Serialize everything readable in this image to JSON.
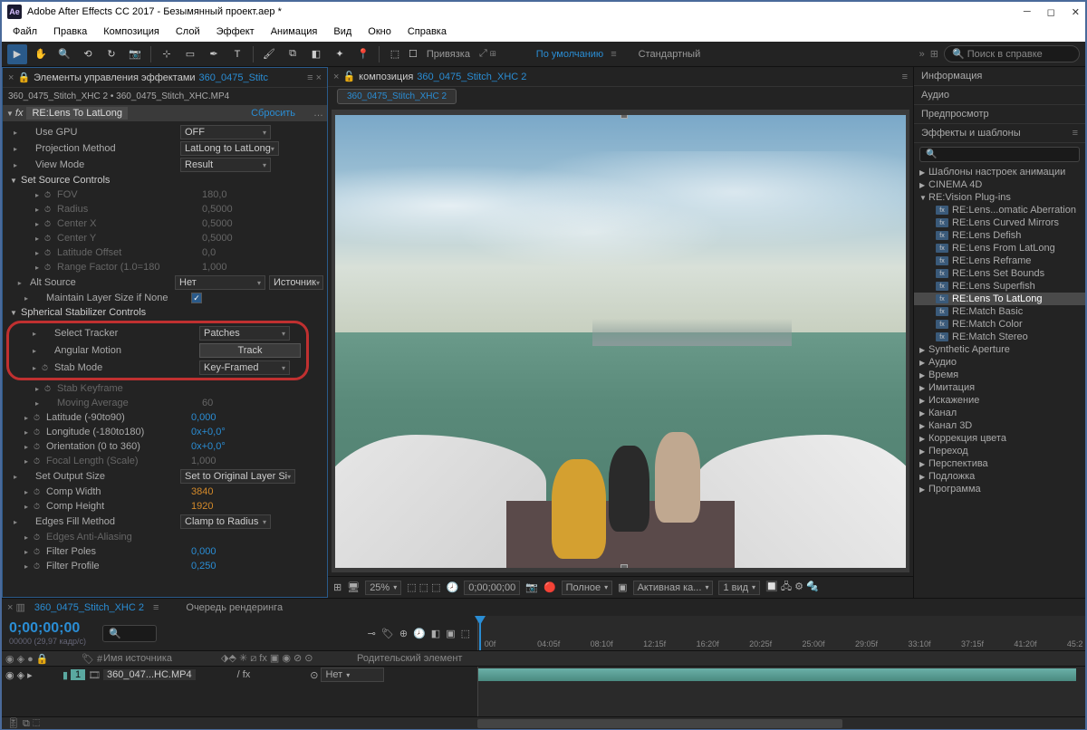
{
  "title": "Adobe After Effects CC 2017 - Безымянный проект.aep *",
  "menus": [
    "Файл",
    "Правка",
    "Композиция",
    "Слой",
    "Эффект",
    "Анимация",
    "Вид",
    "Окно",
    "Справка"
  ],
  "toolbar": {
    "snap_label": "Привязка",
    "workspace1": "По умолчанию",
    "workspace2": "Стандартный",
    "search_placeholder": "Поиск в справке"
  },
  "effects_panel": {
    "tab_prefix": "Элементы управления эффектами",
    "tab_link": "360_0475_Stitc",
    "breadcrumb": "360_0475_Stitch_XHC 2 • 360_0475_Stitch_XHC.MP4",
    "effect_name": "RE:Lens To LatLong",
    "reset": "Сбросить",
    "rows": [
      {
        "t": "prop",
        "name": "Use GPU",
        "val": "OFF",
        "dd": true
      },
      {
        "t": "prop",
        "name": "Projection Method",
        "val": "LatLong to LatLong",
        "dd": true
      },
      {
        "t": "prop",
        "name": "View Mode",
        "val": "Result",
        "dd": true
      },
      {
        "t": "group",
        "name": "Set Source Controls",
        "open": true
      },
      {
        "t": "prop",
        "name": "FOV",
        "val": "180,0",
        "dim": true,
        "i": 2,
        "sw": true
      },
      {
        "t": "prop",
        "name": "Radius",
        "val": "0,5000",
        "dim": true,
        "i": 2,
        "sw": true
      },
      {
        "t": "prop",
        "name": "Center X",
        "val": "0,5000",
        "dim": true,
        "i": 2,
        "sw": true
      },
      {
        "t": "prop",
        "name": "Center Y",
        "val": "0,5000",
        "dim": true,
        "i": 2,
        "sw": true
      },
      {
        "t": "prop",
        "name": "Latitude Offset",
        "val": "0,0",
        "dim": true,
        "i": 2,
        "sw": true
      },
      {
        "t": "prop",
        "name": "Range Factor (1.0=180",
        "val": "1,000",
        "dim": true,
        "i": 2,
        "sw": true
      },
      {
        "t": "prop",
        "name": "Alt Source",
        "val": "Нет",
        "dd": true,
        "extra": "Источник",
        "i": 1
      },
      {
        "t": "prop",
        "name": "Maintain Layer Size if None",
        "cb": true,
        "i": 1
      },
      {
        "t": "group",
        "name": "Spherical Stabilizer Controls",
        "open": true
      },
      {
        "t": "hl_start"
      },
      {
        "t": "prop",
        "name": "Select Tracker",
        "val": "Patches",
        "dd": true,
        "i": 1
      },
      {
        "t": "prop",
        "name": "Angular Motion",
        "val": "Track",
        "btn": true,
        "i": 1
      },
      {
        "t": "prop",
        "name": "Stab Mode",
        "val": "Key-Framed",
        "dd": true,
        "i": 1,
        "sw": true
      },
      {
        "t": "hl_end"
      },
      {
        "t": "prop",
        "name": "Stab Keyframe",
        "val": "",
        "dim": true,
        "i": 2,
        "sw": true
      },
      {
        "t": "prop",
        "name": "Moving Average",
        "val": "60",
        "dim": true,
        "i": 2
      },
      {
        "t": "prop",
        "name": "Latitude (-90to90)",
        "val": "0,000",
        "blue": true,
        "i": 1,
        "sw": true
      },
      {
        "t": "prop",
        "name": "Longitude (-180to180)",
        "val": "0x+0,0°",
        "blue": true,
        "i": 1,
        "sw": true
      },
      {
        "t": "prop",
        "name": "Orientation (0 to 360)",
        "val": "0x+0,0°",
        "blue": true,
        "i": 1,
        "sw": true
      },
      {
        "t": "prop",
        "name": "Focal Length (Scale)",
        "val": "1,000",
        "dim": true,
        "i": 1,
        "sw": true
      },
      {
        "t": "prop",
        "name": "Set Output Size",
        "val": "Set to Original Layer Si",
        "dd": true,
        "i": 0
      },
      {
        "t": "prop",
        "name": "Comp Width",
        "val": "3840",
        "orange": true,
        "i": 1,
        "sw": true
      },
      {
        "t": "prop",
        "name": "Comp Height",
        "val": "1920",
        "orange": true,
        "i": 1,
        "sw": true
      },
      {
        "t": "prop",
        "name": "Edges Fill Method",
        "val": "Clamp to Radius",
        "dd": true,
        "i": 0
      },
      {
        "t": "prop",
        "name": "Edges Anti-Aliasing",
        "val": "",
        "dim": true,
        "i": 1,
        "sw": true
      },
      {
        "t": "prop",
        "name": "Filter Poles",
        "val": "0,000",
        "blue": true,
        "i": 1,
        "sw": true
      },
      {
        "t": "prop",
        "name": "Filter Profile",
        "val": "0,250",
        "blue": true,
        "i": 1,
        "sw": true
      }
    ]
  },
  "composition": {
    "tab_prefix": "композиция",
    "tab_link": "360_0475_Stitch_XHC 2",
    "flow_tab": "360_0475_Stitch_XHC 2",
    "zoom": "25%",
    "timecode": "0;00;00;00",
    "res": "Полное",
    "camera": "Активная ка...",
    "views": "1 вид"
  },
  "right_panel": {
    "sections": [
      "Информация",
      "Аудио",
      "Предпросмотр"
    ],
    "effects_title": "Эффекты и шаблоны",
    "search_placeholder": "",
    "tree": [
      {
        "l": 0,
        "n": "Шаблоны настроек анимации",
        "a": "▶",
        "bold": true
      },
      {
        "l": 0,
        "n": "CINEMA 4D",
        "a": "▶"
      },
      {
        "l": 0,
        "n": "RE:Vision Plug-ins",
        "a": "▼"
      },
      {
        "l": 1,
        "n": "RE:Lens...omatic Aberration",
        "fx": true
      },
      {
        "l": 1,
        "n": "RE:Lens Curved Mirrors",
        "fx": true
      },
      {
        "l": 1,
        "n": "RE:Lens Defish",
        "fx": true
      },
      {
        "l": 1,
        "n": "RE:Lens From LatLong",
        "fx": true
      },
      {
        "l": 1,
        "n": "RE:Lens Reframe",
        "fx": true
      },
      {
        "l": 1,
        "n": "RE:Lens Set Bounds",
        "fx": true
      },
      {
        "l": 1,
        "n": "RE:Lens Superfish",
        "fx": true
      },
      {
        "l": 1,
        "n": "RE:Lens To LatLong",
        "fx": true,
        "sel": true
      },
      {
        "l": 1,
        "n": "RE:Match Basic",
        "fx": true
      },
      {
        "l": 1,
        "n": "RE:Match Color",
        "fx": true
      },
      {
        "l": 1,
        "n": "RE:Match Stereo",
        "fx": true
      },
      {
        "l": 0,
        "n": "Synthetic Aperture",
        "a": "▶"
      },
      {
        "l": 0,
        "n": "Аудио",
        "a": "▶"
      },
      {
        "l": 0,
        "n": "Время",
        "a": "▶"
      },
      {
        "l": 0,
        "n": "Имитация",
        "a": "▶"
      },
      {
        "l": 0,
        "n": "Искажение",
        "a": "▶"
      },
      {
        "l": 0,
        "n": "Канал",
        "a": "▶"
      },
      {
        "l": 0,
        "n": "Канал 3D",
        "a": "▶"
      },
      {
        "l": 0,
        "n": "Коррекция цвета",
        "a": "▶"
      },
      {
        "l": 0,
        "n": "Переход",
        "a": "▶"
      },
      {
        "l": 0,
        "n": "Перспектива",
        "a": "▶"
      },
      {
        "l": 0,
        "n": "Подложка",
        "a": "▶"
      },
      {
        "l": 0,
        "n": "Программа",
        "a": "▶"
      }
    ]
  },
  "timeline": {
    "tab": "360_0475_Stitch_XHC 2",
    "render_queue": "Очередь рендеринга",
    "time": "0;00;00;00",
    "fps": "00000 (29,97 кадр/с)",
    "search_placeholder": "",
    "ticks": [
      "00f",
      "04:05f",
      "08:10f",
      "12:15f",
      "16:20f",
      "20:25f",
      "25:00f",
      "29:05f",
      "33:10f",
      "37:15f",
      "41:20f",
      "45:2"
    ],
    "col_source": "Имя источника",
    "col_parent": "Родительский элемент",
    "layer_num": "1",
    "layer_name": "360_047...HC.MP4",
    "layer_fx": "/ fx",
    "layer_parent": "Нет"
  },
  "statusbar": {
    "label": ""
  }
}
